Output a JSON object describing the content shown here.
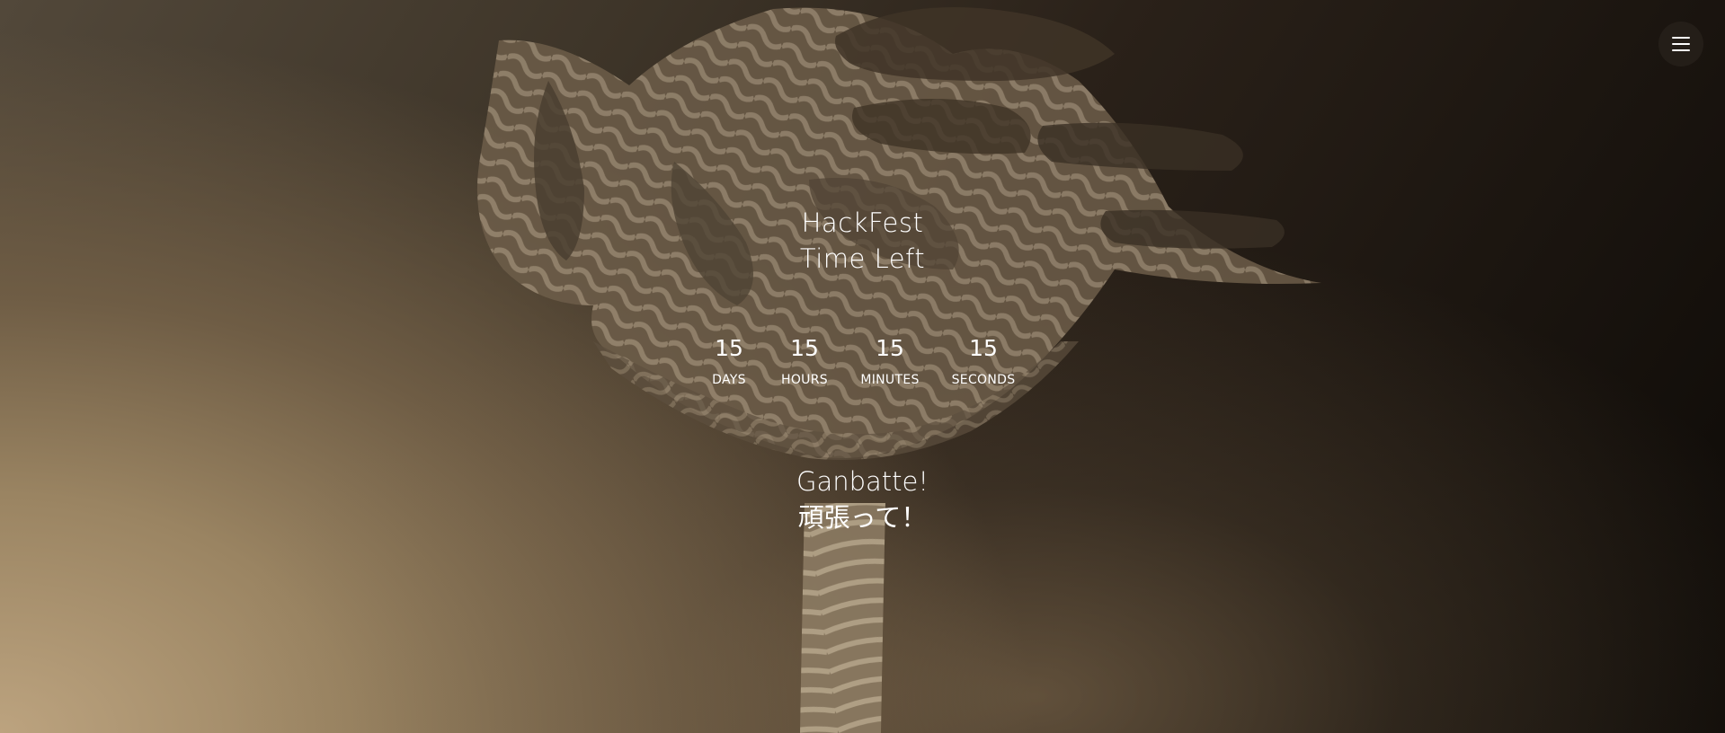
{
  "menu": {
    "icon": "hamburger-icon"
  },
  "header": {
    "title_line1": "HackFest",
    "title_line2": "Time Left"
  },
  "countdown": {
    "days": {
      "value": "15",
      "label": "DAYS"
    },
    "hours": {
      "value": "15",
      "label": "HOURS"
    },
    "minutes": {
      "value": "15",
      "label": "MINUTES"
    },
    "seconds": {
      "value": "15",
      "label": "SECONDS"
    }
  },
  "footer": {
    "line1": "Ganbatte!",
    "line2": "頑張って！"
  },
  "colors": {
    "background_dark": "#0d0a07",
    "background_light": "#bca37f",
    "text": "#ffffff"
  }
}
